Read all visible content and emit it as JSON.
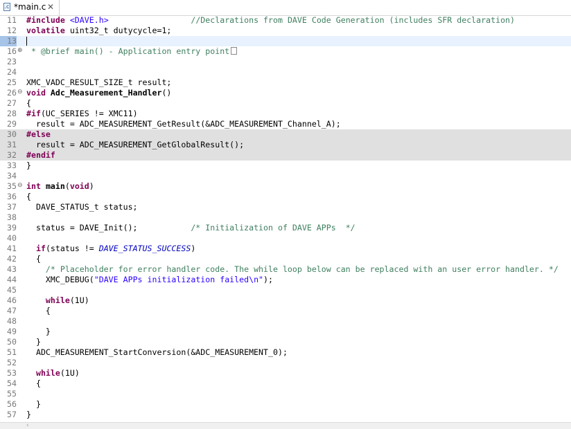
{
  "tab": {
    "title": "*main.c",
    "icon_text": ".c",
    "close_glyph": "✕"
  },
  "lines": [
    {
      "n": "11",
      "segs": [
        {
          "c": "kw",
          "t": "#include"
        },
        {
          "c": "",
          "t": " "
        },
        {
          "c": "inc",
          "t": "<DAVE.h>"
        },
        {
          "c": "",
          "t": "                 "
        },
        {
          "c": "cm",
          "t": "//Declarations from DAVE Code Generation (includes SFR declaration)"
        }
      ]
    },
    {
      "n": "12",
      "segs": [
        {
          "c": "kw",
          "t": "volatile"
        },
        {
          "c": "",
          "t": " uint32_t dutycycle=1;"
        }
      ]
    },
    {
      "n": "13",
      "segs": [],
      "current": true
    },
    {
      "n": "16",
      "fold": "⊕",
      "segs": [
        {
          "c": "cm",
          "t": " * @brief main() - Application entry point"
        }
      ],
      "foldbox": true
    },
    {
      "n": "23",
      "segs": []
    },
    {
      "n": "24",
      "segs": []
    },
    {
      "n": "25",
      "segs": [
        {
          "c": "",
          "t": "XMC_VADC_RESULT_SIZE_t result;"
        }
      ]
    },
    {
      "n": "26",
      "fold": "⊖",
      "segs": [
        {
          "c": "kw",
          "t": "void"
        },
        {
          "c": "",
          "t": " "
        },
        {
          "c": "bold",
          "t": "Adc_Measurement_Handler"
        },
        {
          "c": "",
          "t": "()"
        }
      ]
    },
    {
      "n": "27",
      "segs": [
        {
          "c": "",
          "t": "{"
        }
      ]
    },
    {
      "n": "28",
      "segs": [
        {
          "c": "prep",
          "t": "#if"
        },
        {
          "c": "",
          "t": "(UC_SERIES != XMC11)"
        }
      ]
    },
    {
      "n": "29",
      "segs": [
        {
          "c": "",
          "t": "  result = ADC_MEASUREMENT_GetResult(&ADC_MEASUREMENT_Channel_A);"
        }
      ]
    },
    {
      "n": "30",
      "segs": [
        {
          "c": "prep",
          "t": "#else"
        }
      ],
      "inactive": true
    },
    {
      "n": "31",
      "segs": [
        {
          "c": "",
          "t": "  result = ADC_MEASUREMENT_GetGlobalResult();"
        }
      ],
      "inactive": true
    },
    {
      "n": "32",
      "segs": [
        {
          "c": "prep",
          "t": "#endif"
        }
      ],
      "inactive": true
    },
    {
      "n": "33",
      "segs": [
        {
          "c": "",
          "t": "}"
        }
      ]
    },
    {
      "n": "34",
      "segs": []
    },
    {
      "n": "35",
      "fold": "⊖",
      "segs": [
        {
          "c": "kw",
          "t": "int"
        },
        {
          "c": "",
          "t": " "
        },
        {
          "c": "bold",
          "t": "main"
        },
        {
          "c": "",
          "t": "("
        },
        {
          "c": "kw",
          "t": "void"
        },
        {
          "c": "",
          "t": ")"
        }
      ]
    },
    {
      "n": "36",
      "segs": [
        {
          "c": "",
          "t": "{"
        }
      ]
    },
    {
      "n": "37",
      "segs": [
        {
          "c": "",
          "t": "  DAVE_STATUS_t status;"
        }
      ]
    },
    {
      "n": "38",
      "segs": []
    },
    {
      "n": "39",
      "segs": [
        {
          "c": "",
          "t": "  status = DAVE_Init();           "
        },
        {
          "c": "cm",
          "t": "/* Initialization of DAVE APPs  */"
        }
      ]
    },
    {
      "n": "40",
      "segs": []
    },
    {
      "n": "41",
      "segs": [
        {
          "c": "",
          "t": "  "
        },
        {
          "c": "kw",
          "t": "if"
        },
        {
          "c": "",
          "t": "(status != "
        },
        {
          "c": "enum",
          "t": "DAVE_STATUS_SUCCESS"
        },
        {
          "c": "",
          "t": ")"
        }
      ]
    },
    {
      "n": "42",
      "segs": [
        {
          "c": "",
          "t": "  {"
        }
      ]
    },
    {
      "n": "43",
      "segs": [
        {
          "c": "",
          "t": "    "
        },
        {
          "c": "cm",
          "t": "/* Placeholder for error handler code. The while loop below can be replaced with an user error handler. */"
        }
      ]
    },
    {
      "n": "44",
      "segs": [
        {
          "c": "",
          "t": "    XMC_DEBUG("
        },
        {
          "c": "str",
          "t": "\"DAVE APPs initialization failed\\n\""
        },
        {
          "c": "",
          "t": ");"
        }
      ]
    },
    {
      "n": "45",
      "segs": []
    },
    {
      "n": "46",
      "segs": [
        {
          "c": "",
          "t": "    "
        },
        {
          "c": "kw",
          "t": "while"
        },
        {
          "c": "",
          "t": "(1U)"
        }
      ]
    },
    {
      "n": "47",
      "segs": [
        {
          "c": "",
          "t": "    {"
        }
      ]
    },
    {
      "n": "48",
      "segs": []
    },
    {
      "n": "49",
      "segs": [
        {
          "c": "",
          "t": "    }"
        }
      ]
    },
    {
      "n": "50",
      "segs": [
        {
          "c": "",
          "t": "  }"
        }
      ]
    },
    {
      "n": "51",
      "segs": [
        {
          "c": "",
          "t": "  ADC_MEASUREMENT_StartConversion(&ADC_MEASUREMENT_0);"
        }
      ]
    },
    {
      "n": "52",
      "segs": []
    },
    {
      "n": "53",
      "segs": [
        {
          "c": "",
          "t": "  "
        },
        {
          "c": "kw",
          "t": "while"
        },
        {
          "c": "",
          "t": "(1U)"
        }
      ]
    },
    {
      "n": "54",
      "segs": [
        {
          "c": "",
          "t": "  {"
        }
      ]
    },
    {
      "n": "55",
      "segs": []
    },
    {
      "n": "56",
      "segs": [
        {
          "c": "",
          "t": "  }"
        }
      ]
    },
    {
      "n": "57",
      "segs": [
        {
          "c": "",
          "t": "}"
        }
      ]
    }
  ],
  "scroll": {
    "left_glyph": "‹"
  }
}
